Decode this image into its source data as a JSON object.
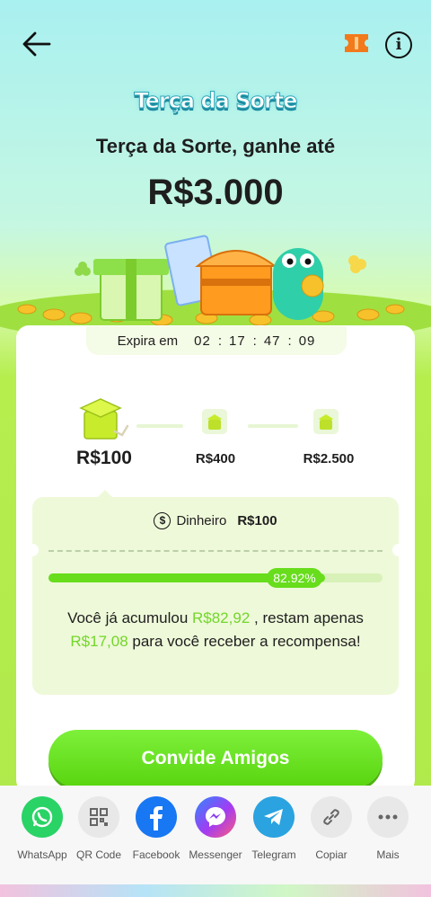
{
  "header": {
    "back_icon": "arrow-left-icon",
    "ticket_icon": "ticket-icon",
    "info_label": "i"
  },
  "promo": {
    "logo_text": "Terça da Sorte",
    "headline": "Terça da Sorte, ganhe até",
    "amount": "R$3.000"
  },
  "timer": {
    "label": "Expira em",
    "hours": "02",
    "minutes": "17",
    "seconds": "47",
    "frames": "09",
    "separator": ":"
  },
  "milestones": [
    {
      "value": "R$100",
      "active": true
    },
    {
      "value": "R$400",
      "active": false
    },
    {
      "value": "R$2.500",
      "active": false
    }
  ],
  "reward": {
    "label": "Dinheiro",
    "value": "R$100",
    "icon": "dollar-circle-icon"
  },
  "progress": {
    "percent_label": "82.92%",
    "fraction": 0.8292
  },
  "message": {
    "part1": "Você já acumulou ",
    "accumulated": "R$82,92",
    "part2": " , restam apenas ",
    "remaining": "R$17,08",
    "part3": " para você receber a recompensa!"
  },
  "invite_button": "Convide Amigos",
  "share": [
    {
      "label": "WhatsApp",
      "icon": "whatsapp-icon",
      "color": "#29d366"
    },
    {
      "label": "QR Code",
      "icon": "qr-code-icon",
      "color": "#e8e8e8"
    },
    {
      "label": "Facebook",
      "icon": "facebook-icon",
      "color": "#1877f2"
    },
    {
      "label": "Messenger",
      "icon": "messenger-icon",
      "color": "#a33bf2"
    },
    {
      "label": "Telegram",
      "icon": "telegram-icon",
      "color": "#2aa3e0"
    },
    {
      "label": "Copiar",
      "icon": "link-icon",
      "color": "#e8e8e8"
    },
    {
      "label": "Mais",
      "icon": "more-icon",
      "color": "#e8e8e8"
    }
  ]
}
